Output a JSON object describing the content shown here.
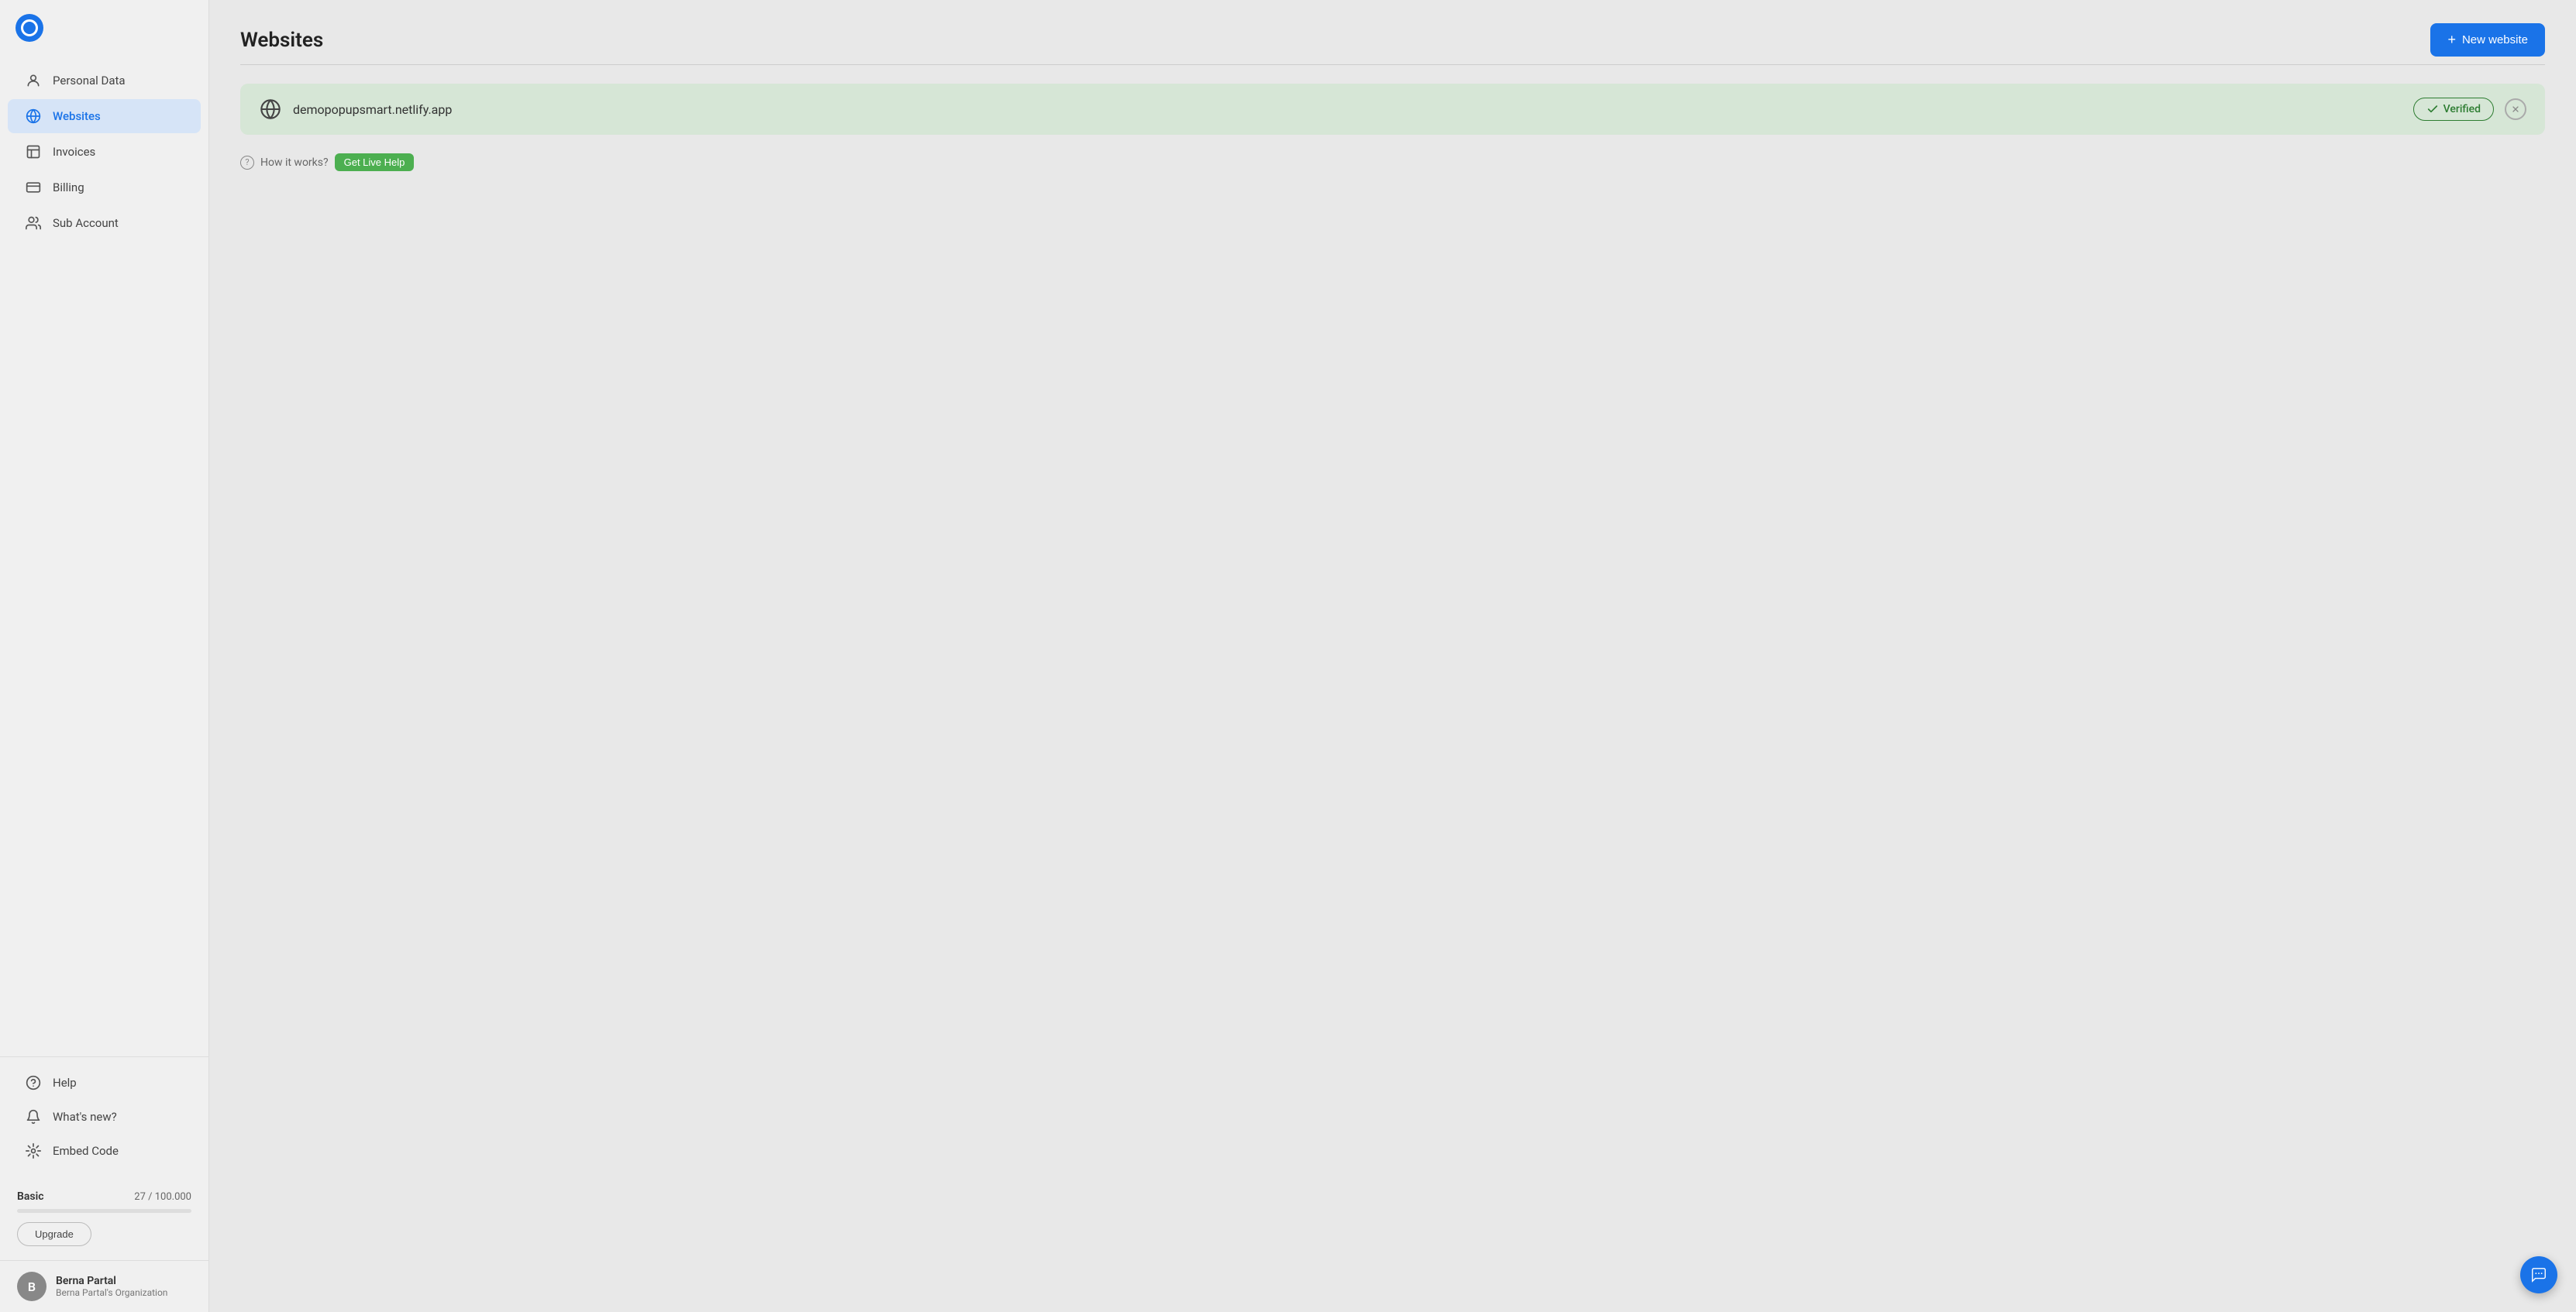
{
  "app": {
    "logo_alt": "Popupsmart logo"
  },
  "sidebar": {
    "nav_items": [
      {
        "id": "personal-data",
        "label": "Personal Data",
        "icon": "person"
      },
      {
        "id": "websites",
        "label": "Websites",
        "icon": "globe",
        "active": true
      },
      {
        "id": "invoices",
        "label": "Invoices",
        "icon": "invoice"
      },
      {
        "id": "billing",
        "label": "Billing",
        "icon": "billing"
      },
      {
        "id": "sub-account",
        "label": "Sub Account",
        "icon": "people"
      }
    ],
    "bottom_items": [
      {
        "id": "help",
        "label": "Help",
        "icon": "help"
      },
      {
        "id": "whats-new",
        "label": "What's new?",
        "icon": "bell"
      },
      {
        "id": "embed-code",
        "label": "Embed Code",
        "icon": "embed"
      }
    ],
    "plan": {
      "name": "Basic",
      "usage_current": "27",
      "usage_max": "100.000",
      "usage_text": "27 / 100.000",
      "upgrade_label": "Upgrade"
    },
    "user": {
      "name": "Berna Partal",
      "org": "Berna Partal's Organization",
      "avatar_initials": "B"
    }
  },
  "main": {
    "title": "Websites",
    "new_website_label": "New website",
    "website_item": {
      "url": "demopopupsmart.netlify.app",
      "verified_label": "Verified"
    },
    "how_it_works": {
      "text": "How it works?",
      "live_help_label": "Get Live Help"
    }
  }
}
